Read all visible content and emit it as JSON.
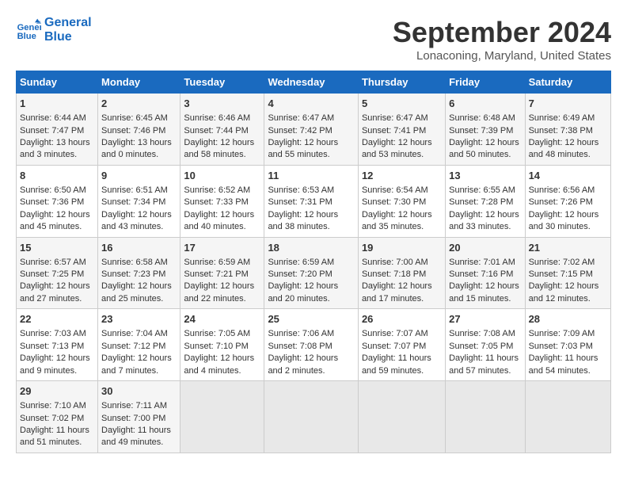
{
  "logo": {
    "line1": "General",
    "line2": "Blue"
  },
  "title": "September 2024",
  "subtitle": "Lonaconing, Maryland, United States",
  "headers": [
    "Sunday",
    "Monday",
    "Tuesday",
    "Wednesday",
    "Thursday",
    "Friday",
    "Saturday"
  ],
  "weeks": [
    [
      {
        "day": "1",
        "sunrise": "6:44 AM",
        "sunset": "7:47 PM",
        "daylight": "13 hours and 3 minutes."
      },
      {
        "day": "2",
        "sunrise": "6:45 AM",
        "sunset": "7:46 PM",
        "daylight": "13 hours and 0 minutes."
      },
      {
        "day": "3",
        "sunrise": "6:46 AM",
        "sunset": "7:44 PM",
        "daylight": "12 hours and 58 minutes."
      },
      {
        "day": "4",
        "sunrise": "6:47 AM",
        "sunset": "7:42 PM",
        "daylight": "12 hours and 55 minutes."
      },
      {
        "day": "5",
        "sunrise": "6:47 AM",
        "sunset": "7:41 PM",
        "daylight": "12 hours and 53 minutes."
      },
      {
        "day": "6",
        "sunrise": "6:48 AM",
        "sunset": "7:39 PM",
        "daylight": "12 hours and 50 minutes."
      },
      {
        "day": "7",
        "sunrise": "6:49 AM",
        "sunset": "7:38 PM",
        "daylight": "12 hours and 48 minutes."
      }
    ],
    [
      {
        "day": "8",
        "sunrise": "6:50 AM",
        "sunset": "7:36 PM",
        "daylight": "12 hours and 45 minutes."
      },
      {
        "day": "9",
        "sunrise": "6:51 AM",
        "sunset": "7:34 PM",
        "daylight": "12 hours and 43 minutes."
      },
      {
        "day": "10",
        "sunrise": "6:52 AM",
        "sunset": "7:33 PM",
        "daylight": "12 hours and 40 minutes."
      },
      {
        "day": "11",
        "sunrise": "6:53 AM",
        "sunset": "7:31 PM",
        "daylight": "12 hours and 38 minutes."
      },
      {
        "day": "12",
        "sunrise": "6:54 AM",
        "sunset": "7:30 PM",
        "daylight": "12 hours and 35 minutes."
      },
      {
        "day": "13",
        "sunrise": "6:55 AM",
        "sunset": "7:28 PM",
        "daylight": "12 hours and 33 minutes."
      },
      {
        "day": "14",
        "sunrise": "6:56 AM",
        "sunset": "7:26 PM",
        "daylight": "12 hours and 30 minutes."
      }
    ],
    [
      {
        "day": "15",
        "sunrise": "6:57 AM",
        "sunset": "7:25 PM",
        "daylight": "12 hours and 27 minutes."
      },
      {
        "day": "16",
        "sunrise": "6:58 AM",
        "sunset": "7:23 PM",
        "daylight": "12 hours and 25 minutes."
      },
      {
        "day": "17",
        "sunrise": "6:59 AM",
        "sunset": "7:21 PM",
        "daylight": "12 hours and 22 minutes."
      },
      {
        "day": "18",
        "sunrise": "6:59 AM",
        "sunset": "7:20 PM",
        "daylight": "12 hours and 20 minutes."
      },
      {
        "day": "19",
        "sunrise": "7:00 AM",
        "sunset": "7:18 PM",
        "daylight": "12 hours and 17 minutes."
      },
      {
        "day": "20",
        "sunrise": "7:01 AM",
        "sunset": "7:16 PM",
        "daylight": "12 hours and 15 minutes."
      },
      {
        "day": "21",
        "sunrise": "7:02 AM",
        "sunset": "7:15 PM",
        "daylight": "12 hours and 12 minutes."
      }
    ],
    [
      {
        "day": "22",
        "sunrise": "7:03 AM",
        "sunset": "7:13 PM",
        "daylight": "12 hours and 9 minutes."
      },
      {
        "day": "23",
        "sunrise": "7:04 AM",
        "sunset": "7:12 PM",
        "daylight": "12 hours and 7 minutes."
      },
      {
        "day": "24",
        "sunrise": "7:05 AM",
        "sunset": "7:10 PM",
        "daylight": "12 hours and 4 minutes."
      },
      {
        "day": "25",
        "sunrise": "7:06 AM",
        "sunset": "7:08 PM",
        "daylight": "12 hours and 2 minutes."
      },
      {
        "day": "26",
        "sunrise": "7:07 AM",
        "sunset": "7:07 PM",
        "daylight": "11 hours and 59 minutes."
      },
      {
        "day": "27",
        "sunrise": "7:08 AM",
        "sunset": "7:05 PM",
        "daylight": "11 hours and 57 minutes."
      },
      {
        "day": "28",
        "sunrise": "7:09 AM",
        "sunset": "7:03 PM",
        "daylight": "11 hours and 54 minutes."
      }
    ],
    [
      {
        "day": "29",
        "sunrise": "7:10 AM",
        "sunset": "7:02 PM",
        "daylight": "11 hours and 51 minutes."
      },
      {
        "day": "30",
        "sunrise": "7:11 AM",
        "sunset": "7:00 PM",
        "daylight": "11 hours and 49 minutes."
      },
      null,
      null,
      null,
      null,
      null
    ]
  ]
}
